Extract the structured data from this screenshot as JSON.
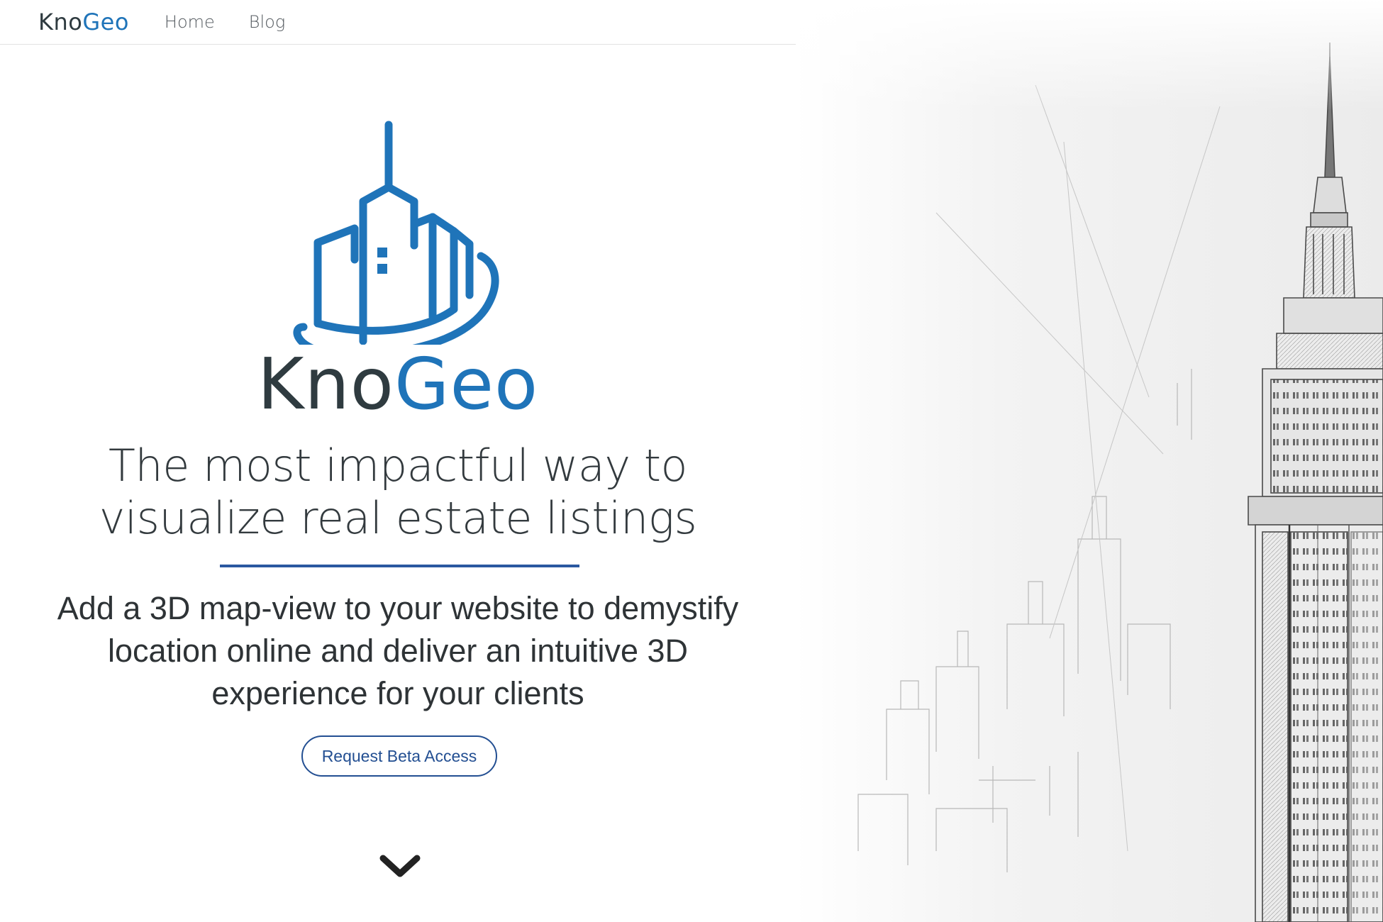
{
  "navbar": {
    "brand_kno": "Kno",
    "brand_geo": "Geo",
    "links": [
      "Home",
      "Blog"
    ]
  },
  "hero": {
    "logo_kno": "Kno",
    "logo_geo": "Geo",
    "tagline": "The most impactful way to visualize real estate listings",
    "subtext": "Add a 3D map-view to your website to demystify location online and deliver an intuitive 3D experience for your clients",
    "cta_label": "Request Beta Access"
  },
  "icons": {
    "logo": "city-skyline-logo-icon",
    "scroll": "chevron-down-icon"
  },
  "colors": {
    "brand_blue": "#1f74b9",
    "brand_dark": "#2f3b40",
    "accent_line": "#2a58a0",
    "cta_border": "#234f92"
  }
}
